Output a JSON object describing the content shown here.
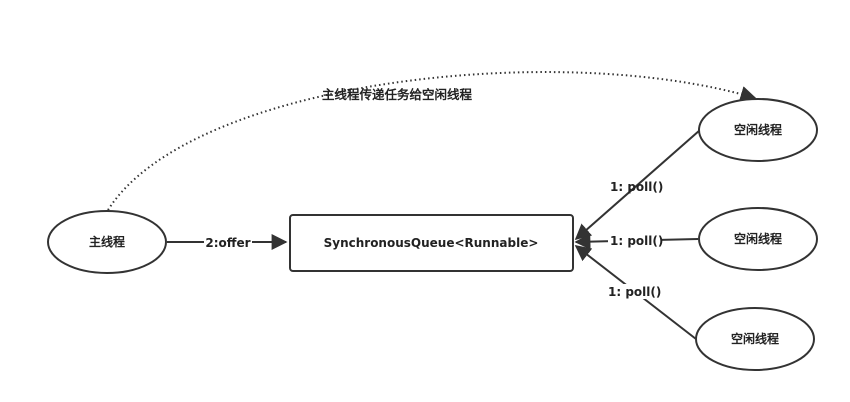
{
  "nodes": {
    "main_thread": "主线程",
    "queue": "SynchronousQueue<Runnable>",
    "idle_thread_1": "空闲线程",
    "idle_thread_2": "空闲线程",
    "idle_thread_3": "空闲线程"
  },
  "edges": {
    "offer": "2:offer",
    "poll_1": "1: poll()",
    "poll_2": "1: poll()",
    "poll_3": "1: poll()",
    "handoff": "主线程传递任务给空闲线程"
  },
  "colors": {
    "stroke": "#333333",
    "text": "#222222",
    "background": "#ffffff"
  }
}
